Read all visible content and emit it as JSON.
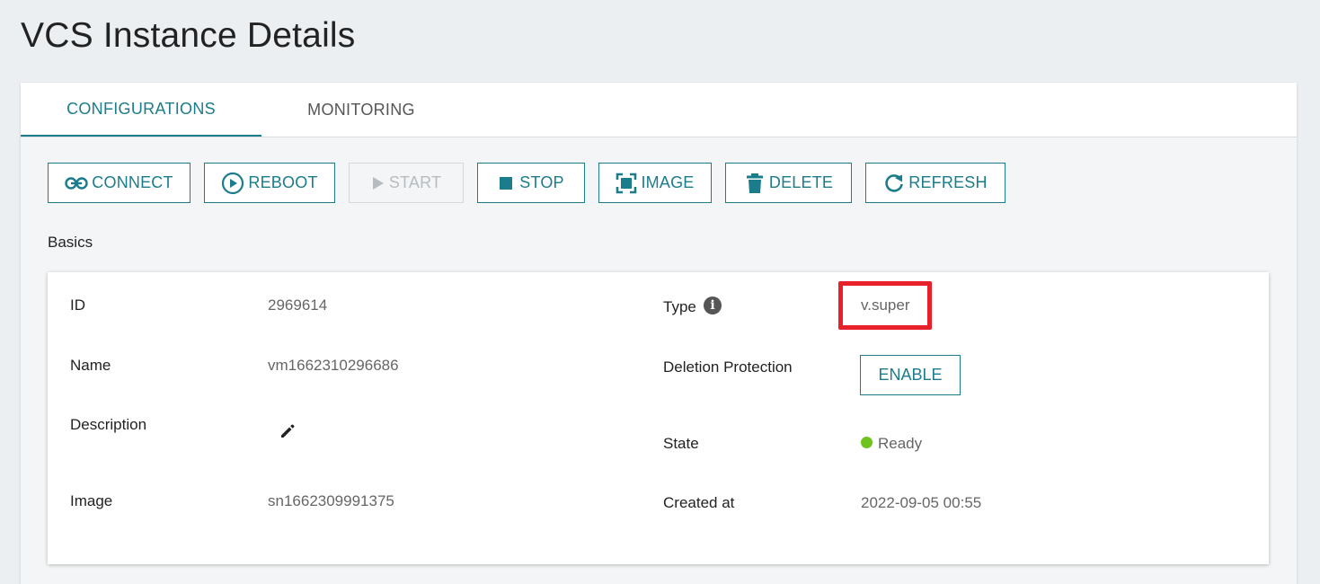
{
  "page": {
    "title": "VCS Instance Details"
  },
  "tabs": [
    {
      "label": "CONFIGURATIONS",
      "active": true
    },
    {
      "label": "MONITORING",
      "active": false
    }
  ],
  "toolbar": {
    "connect": "CONNECT",
    "reboot": "REBOOT",
    "start": "START",
    "stop": "STOP",
    "image": "IMAGE",
    "delete": "DELETE",
    "refresh": "REFRESH"
  },
  "basics": {
    "section_label": "Basics",
    "id_label": "ID",
    "id_value": "2969614",
    "name_label": "Name",
    "name_value": "vm1662310296686",
    "description_label": "Description",
    "image_label": "Image",
    "image_value": "sn1662309991375",
    "type_label": "Type",
    "type_value": "v.super",
    "deletion_protection_label": "Deletion Protection",
    "deletion_protection_button": "ENABLE",
    "state_label": "State",
    "state_value": "Ready",
    "created_at_label": "Created at",
    "created_at_value": "2022-09-05 00:55"
  },
  "colors": {
    "accent": "#1b7c8c",
    "highlight": "#e8202a",
    "status_ready": "#6ec31f"
  },
  "icons": {
    "connect": "link-icon",
    "reboot": "play-circle-icon",
    "start": "play-icon",
    "stop": "stop-icon",
    "image": "image-capture-icon",
    "delete": "trash-icon",
    "refresh": "refresh-icon",
    "type_info": "info-icon",
    "description_edit": "pencil-icon"
  }
}
